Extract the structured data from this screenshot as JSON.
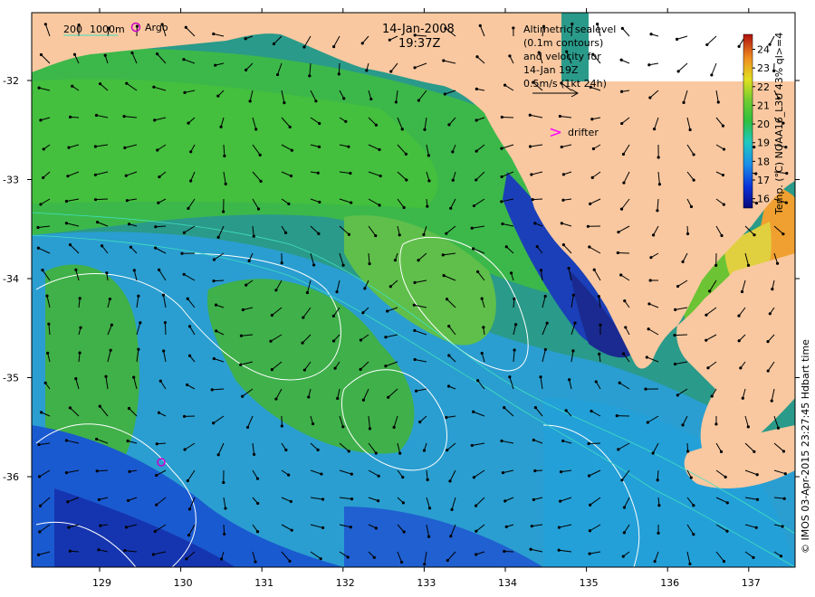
{
  "map": {
    "date": "14-Jan-2008",
    "time": "19:37Z",
    "scale_labels": [
      "200",
      "1000m"
    ],
    "argo_label": "Argo",
    "drifter_label": "drifter",
    "drifter_symbol": ">",
    "legend_text": [
      "Altimetric sealevel",
      "(0.1m contours)",
      "and velocity for",
      "14-Jan 19Z",
      "0.5m/s (1kt 24h)"
    ],
    "colorbar": {
      "label": "Temp. (°C) NOAA16_L3U 43% ql>=4",
      "ticks": [
        "24",
        "23",
        "22",
        "21",
        "20",
        "19",
        "18",
        "17",
        "16"
      ],
      "min": 15.5,
      "max": 24.8
    },
    "credit": "© IMOS 03-Apr-2015 23:27:45 Hdbart time",
    "lon_ticks": [
      "129",
      "130",
      "131",
      "132",
      "133",
      "134",
      "135",
      "136",
      "137"
    ],
    "lat_ticks": [
      "-32",
      "-33",
      "-34",
      "-35",
      "-36"
    ],
    "colors": {
      "land": "#f9c8a0",
      "drifter": "#ff00ff",
      "argo": "#cc00cc",
      "isobath": "#40e0c0",
      "contour": "#ffffff"
    }
  }
}
